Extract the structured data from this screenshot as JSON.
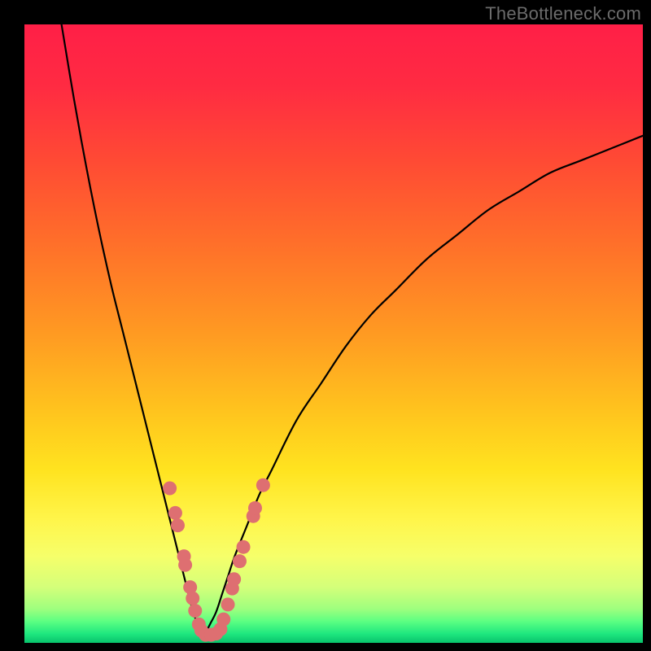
{
  "attribution": "TheBottleneck.com",
  "colors": {
    "frame": "#000000",
    "curve_stroke": "#000000",
    "dot_fill": "#de6f71",
    "dot_stroke": "#c45a5c",
    "gradient_stops": [
      {
        "offset": 0.0,
        "color": "#ff1f47"
      },
      {
        "offset": 0.1,
        "color": "#ff2b42"
      },
      {
        "offset": 0.22,
        "color": "#ff4a34"
      },
      {
        "offset": 0.35,
        "color": "#ff6e2a"
      },
      {
        "offset": 0.5,
        "color": "#ff9a22"
      },
      {
        "offset": 0.62,
        "color": "#ffc21e"
      },
      {
        "offset": 0.72,
        "color": "#ffe31f"
      },
      {
        "offset": 0.8,
        "color": "#fff54a"
      },
      {
        "offset": 0.86,
        "color": "#f6ff6a"
      },
      {
        "offset": 0.91,
        "color": "#d4ff7a"
      },
      {
        "offset": 0.945,
        "color": "#9fff7e"
      },
      {
        "offset": 0.965,
        "color": "#5dff82"
      },
      {
        "offset": 0.985,
        "color": "#1fe87f"
      },
      {
        "offset": 1.0,
        "color": "#08c36c"
      }
    ]
  },
  "chart_data": {
    "type": "line",
    "title": "",
    "xlabel": "",
    "ylabel": "",
    "xlim": [
      0,
      100
    ],
    "ylim": [
      0,
      100
    ],
    "x_at_minimum": 29,
    "series": [
      {
        "name": "left-branch",
        "x": [
          6,
          8,
          10,
          12,
          14,
          16,
          18,
          20,
          22,
          24,
          25,
          26,
          27,
          28,
          29
        ],
        "y": [
          100,
          88,
          77,
          67,
          58,
          50,
          42,
          34,
          26,
          18,
          14,
          10,
          6,
          3,
          1
        ]
      },
      {
        "name": "right-branch",
        "x": [
          29,
          30,
          31,
          32,
          33,
          34,
          36,
          38,
          40,
          44,
          48,
          52,
          56,
          60,
          65,
          70,
          75,
          80,
          85,
          90,
          95,
          100
        ],
        "y": [
          1,
          3,
          5,
          8,
          11,
          14,
          19,
          24,
          28,
          36,
          42,
          48,
          53,
          57,
          62,
          66,
          70,
          73,
          76,
          78,
          80,
          82
        ]
      }
    ],
    "markers": {
      "name": "highlighted-points",
      "style": "pink-dots",
      "points": [
        {
          "x": 23.5,
          "y": 25
        },
        {
          "x": 24.4,
          "y": 21
        },
        {
          "x": 24.8,
          "y": 19
        },
        {
          "x": 25.8,
          "y": 14
        },
        {
          "x": 26.0,
          "y": 12.6
        },
        {
          "x": 26.8,
          "y": 9.0
        },
        {
          "x": 27.2,
          "y": 7.2
        },
        {
          "x": 27.6,
          "y": 5.2
        },
        {
          "x": 28.2,
          "y": 3.0
        },
        {
          "x": 28.6,
          "y": 2.0
        },
        {
          "x": 29.3,
          "y": 1.3
        },
        {
          "x": 30.2,
          "y": 1.3
        },
        {
          "x": 31.0,
          "y": 1.5
        },
        {
          "x": 31.7,
          "y": 2.2
        },
        {
          "x": 32.2,
          "y": 3.8
        },
        {
          "x": 32.9,
          "y": 6.2
        },
        {
          "x": 33.6,
          "y": 8.8
        },
        {
          "x": 33.9,
          "y": 10.3
        },
        {
          "x": 34.8,
          "y": 13.2
        },
        {
          "x": 35.4,
          "y": 15.5
        },
        {
          "x": 37.0,
          "y": 20.5
        },
        {
          "x": 37.3,
          "y": 21.8
        },
        {
          "x": 38.6,
          "y": 25.5
        }
      ]
    }
  }
}
